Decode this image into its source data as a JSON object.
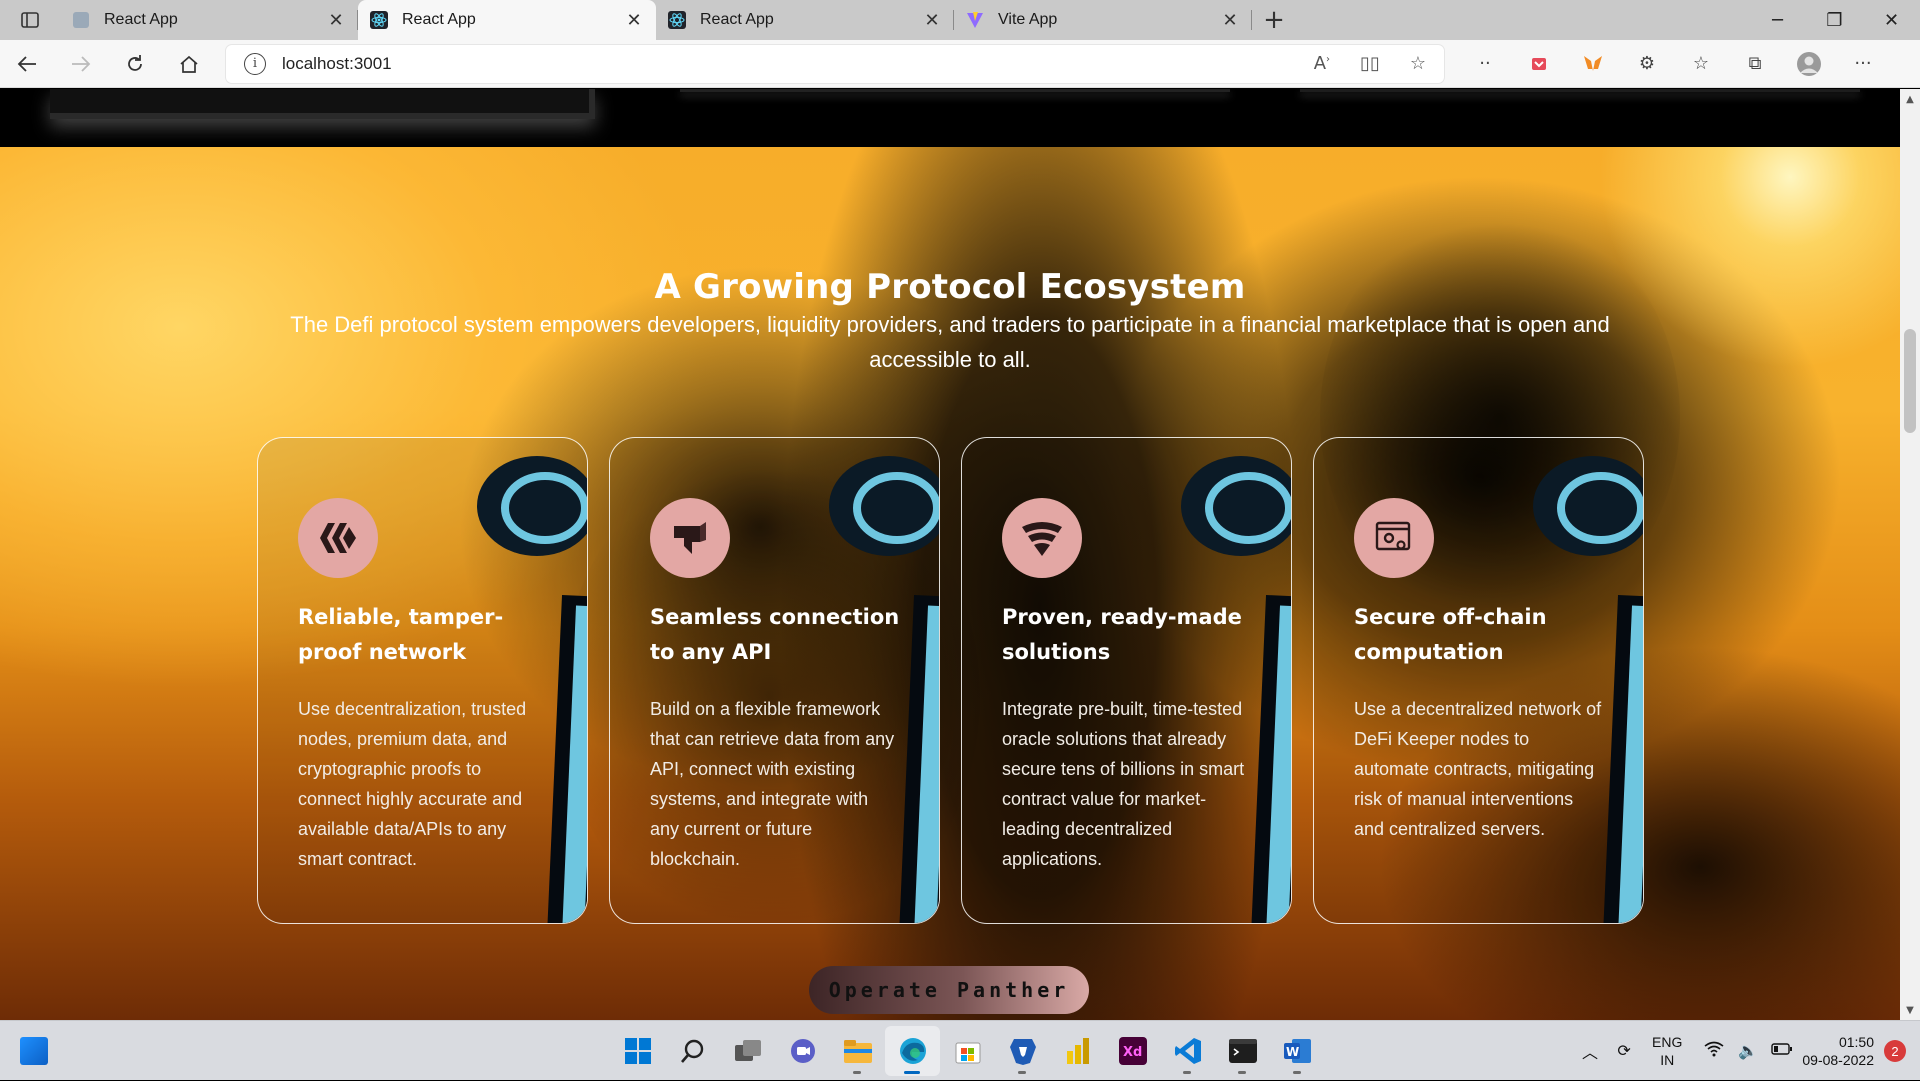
{
  "browser": {
    "tabs": [
      {
        "label": "React App",
        "icon": "react-icon",
        "active": false
      },
      {
        "label": "React App",
        "icon": "react-icon",
        "active": true
      },
      {
        "label": "React App",
        "icon": "react-icon",
        "active": false
      },
      {
        "label": "Vite App",
        "icon": "vite-icon",
        "active": false
      }
    ],
    "url": "localhost:3001"
  },
  "page": {
    "heading": "A Growing Protocol Ecosystem",
    "subtitle": "The Defi protocol system empowers developers, liquidity providers, and traders to participate in a financial marketplace that is open and accessible to all.",
    "cards": [
      {
        "icon": "hive-icon",
        "title": "Reliable, tamper-proof network",
        "body": "Use decentralization, trusted nodes, premium data, and cryptographic proofs to connect highly accurate and available data/APIs to any smart contract."
      },
      {
        "icon": "api-connection-icon",
        "title": "Seamless connection to any API",
        "body": "Build on a flexible framework that can retrieve data from any API, connect with existing systems, and integrate with any current or future blockchain."
      },
      {
        "icon": "f-secure-icon",
        "title": "Proven, ready-made solutions",
        "body": "Integrate pre-built, time-tested oracle solutions that already secure tens of billions in smart contract value for market-leading decentralized applications."
      },
      {
        "icon": "settings-window-icon",
        "title": "Secure off-chain computation",
        "body": "Use a decentralized network of DeFi Keeper nodes to automate contracts, mitigating risk of manual interventions and centralized servers."
      }
    ],
    "cta_label": "Operate Panther"
  },
  "taskbar": {
    "apps": [
      "start-icon",
      "search-icon",
      "task-view-icon",
      "chat-icon",
      "file-explorer-icon",
      "edge-icon",
      "store-icon",
      "brave-icon",
      "power-bi-icon",
      "adobe-xd-icon",
      "vscode-icon",
      "terminal-icon",
      "word-icon"
    ],
    "language": "ENG",
    "region": "IN",
    "time": "01:50",
    "date": "09-08-2022",
    "notification_count": "2"
  },
  "colors": {
    "icon_circle": "#e3a7a4",
    "tube_blue": "#6ec6e0",
    "hero_gold": "#f8b22d"
  }
}
